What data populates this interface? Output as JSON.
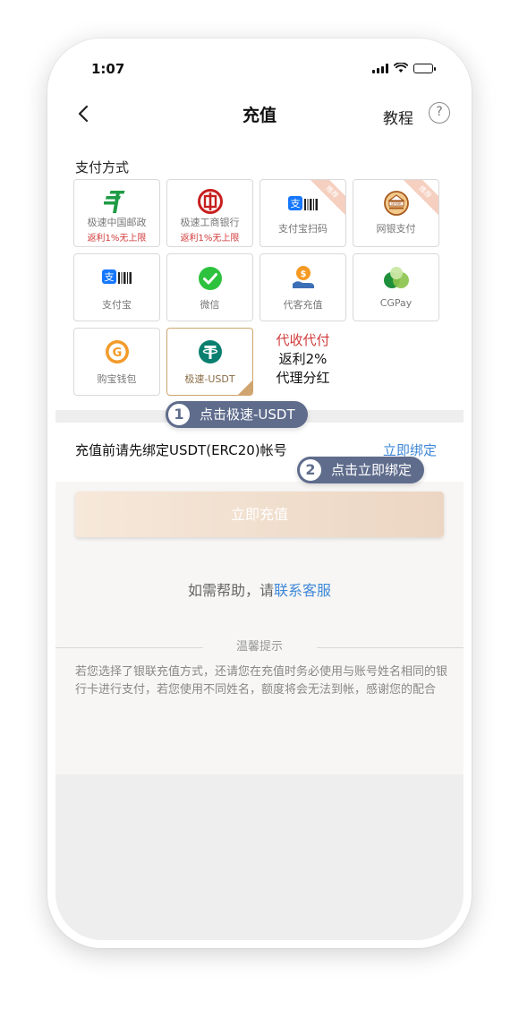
{
  "status_bar": {
    "time": "1:07"
  },
  "header": {
    "title": "充值",
    "tutorial_label": "教程",
    "help_symbol": "?"
  },
  "payment": {
    "section_label": "支付方式",
    "methods": [
      {
        "name": "极速中国邮政",
        "sub": "返利1%无上限",
        "icon": "china-post-icon"
      },
      {
        "name": "极速工商银行",
        "sub": "返利1%无上限",
        "icon": "icbc-icon"
      },
      {
        "name": "支付宝扫码",
        "badge": "推荐",
        "icon": "alipay-scan-icon"
      },
      {
        "name": "网银支付",
        "badge": "推荐",
        "icon": "bank-icon"
      },
      {
        "name": "支付宝",
        "icon": "alipay-icon"
      },
      {
        "name": "微信",
        "icon": "wechat-icon"
      },
      {
        "name": "代客充值",
        "icon": "agent-deposit-icon"
      },
      {
        "name": "CGPay",
        "icon": "cgpay-icon"
      },
      {
        "name": "购宝钱包",
        "icon": "goubao-wallet-icon"
      },
      {
        "name": "极速-USDT",
        "icon": "usdt-icon",
        "selected": true
      }
    ],
    "promo": {
      "line1": "代收代付",
      "line2": "返利2%",
      "line3": "代理分红"
    }
  },
  "tips": [
    {
      "number": "1",
      "text": "点击极速-USDT"
    },
    {
      "number": "2",
      "text": "点击立即绑定"
    }
  ],
  "binding": {
    "text": "充值前请先绑定USDT(ERC20)帐号",
    "link": "立即绑定"
  },
  "cta": {
    "label": "立即充值"
  },
  "help": {
    "prefix": "如需帮助，请",
    "link": "联系客服"
  },
  "notice": {
    "title": "温馨提示",
    "body": "若您选择了银联充值方式，还请您在充值时务必使用与账号姓名相同的银行卡进行支付，若您使用不同姓名，额度将会无法到帐，感谢您的配合"
  },
  "colors": {
    "accent_blue": "#3f88d8",
    "promo_red": "#d23b3b",
    "tip_bg": "#5f6c8c",
    "selected_border": "#cfa46f"
  }
}
